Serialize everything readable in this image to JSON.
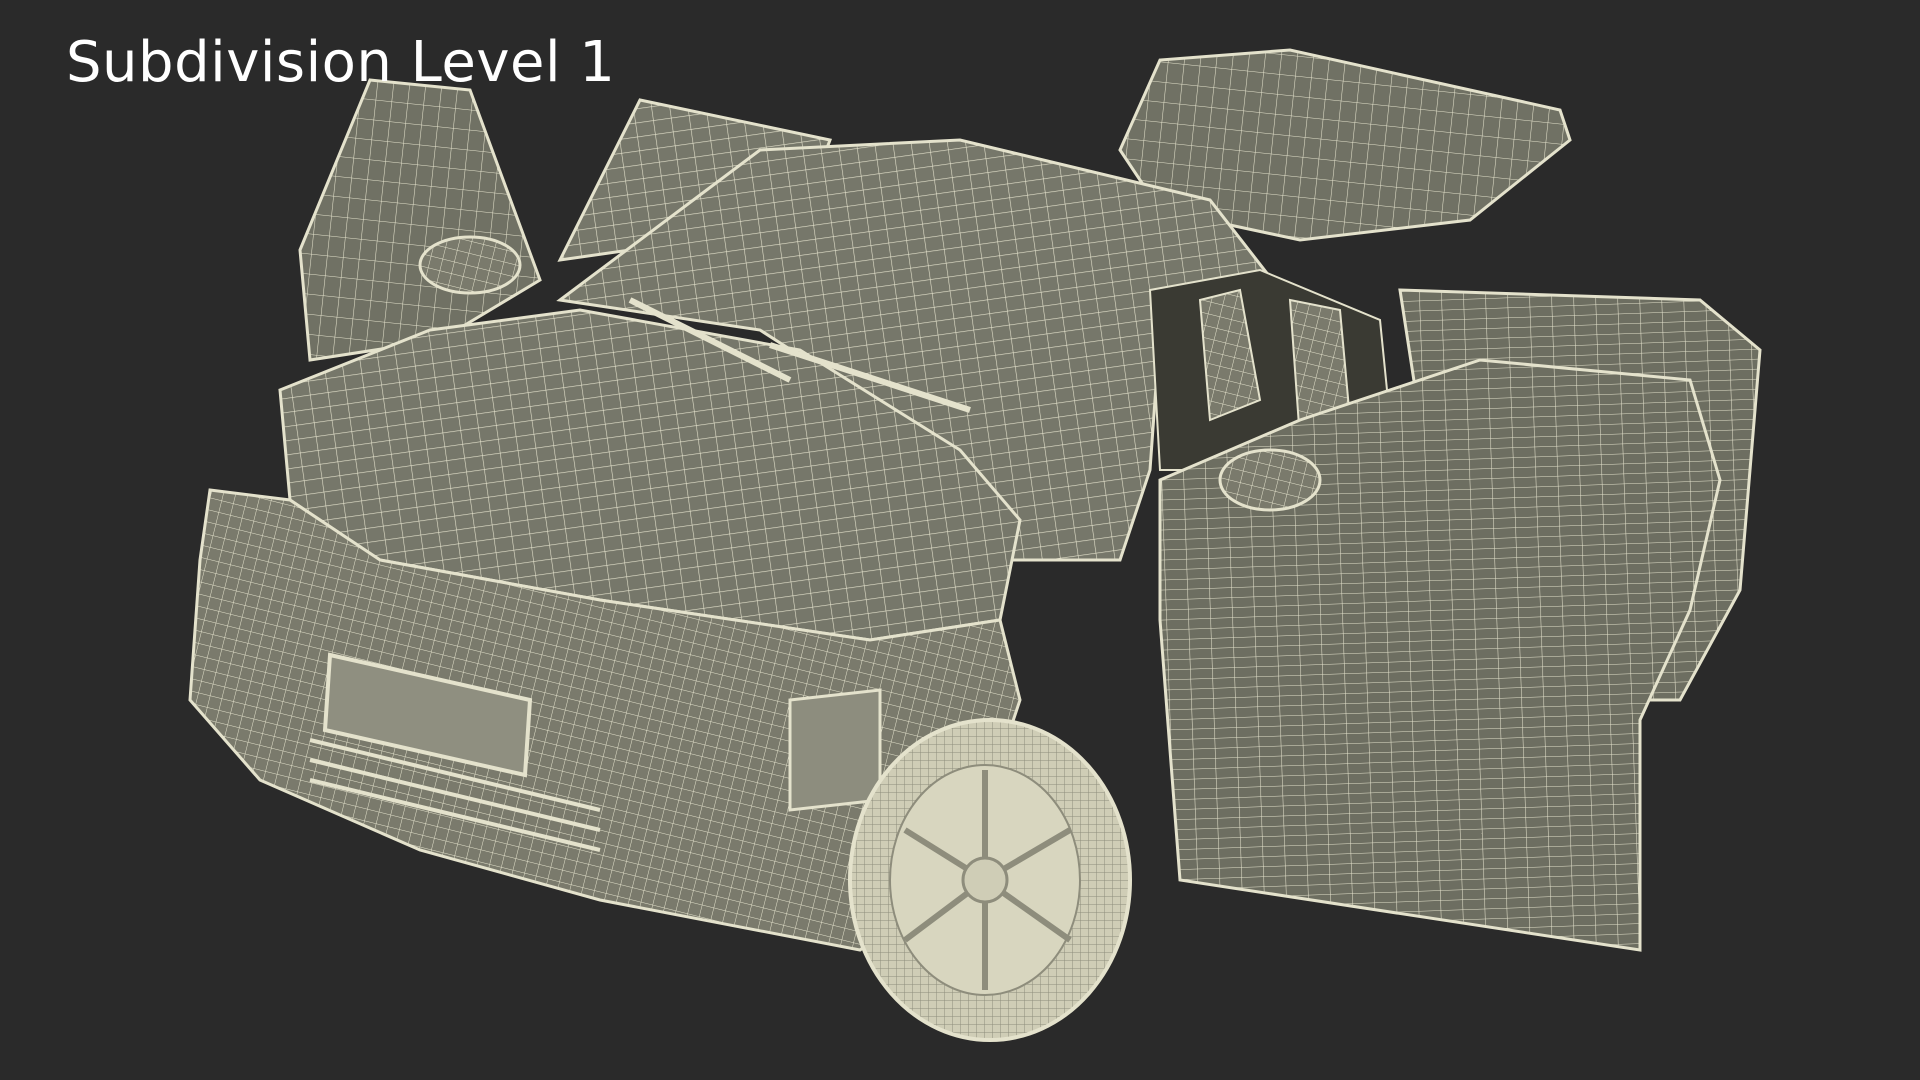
{
  "caption": "Subdivision Level 1",
  "colors": {
    "background": "#2a2a2a",
    "body_fill": "#7d7d6f",
    "panel_fill": "#6f7062",
    "wire": "#e4e2cc",
    "caption": "#ffffff"
  },
  "icons": [
    "car-wireframe"
  ]
}
